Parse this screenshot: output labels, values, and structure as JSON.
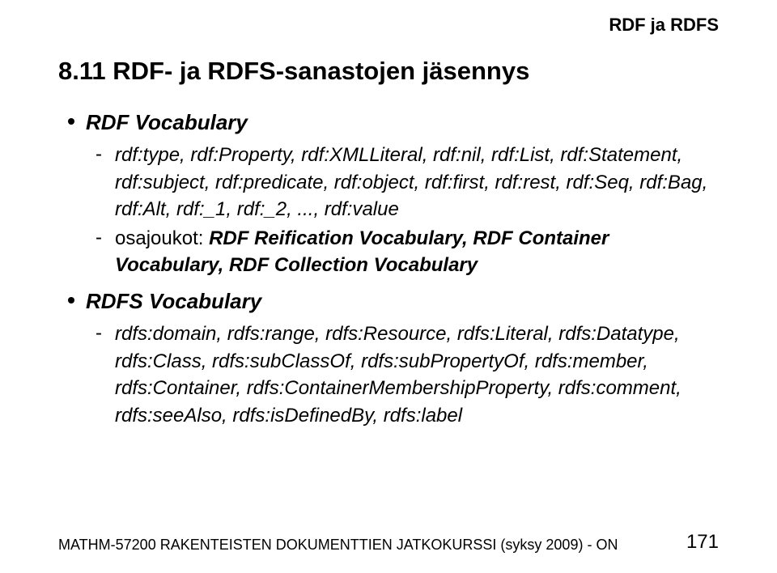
{
  "header": "RDF ja RDFS",
  "title": "8.11 RDF- ja RDFS-sanastojen jäsennys",
  "sections": [
    {
      "heading": "RDF Vocabulary",
      "items": [
        {
          "text": "rdf:type, rdf:Property, rdf:XMLLiteral, rdf:nil, rdf:List, rdf:Statement, rdf:subject, rdf:predicate, rdf:object, rdf:first, rdf:rest, rdf:Seq, rdf:Bag, rdf:Alt, rdf:_1, rdf:_2, ..., rdf:value"
        },
        {
          "prefix": "osajoukot:  ",
          "bold": "RDF Reification Vocabulary, RDF Container Vocabulary, RDF Collection Vocabulary"
        }
      ]
    },
    {
      "heading": "RDFS Vocabulary",
      "items": [
        {
          "text": "rdfs:domain, rdfs:range, rdfs:Resource, rdfs:Literal, rdfs:Datatype, rdfs:Class, rdfs:subClassOf, rdfs:subPropertyOf, rdfs:member, rdfs:Container, rdfs:ContainerMembershipProperty, rdfs:comment, rdfs:seeAlso, rdfs:isDefinedBy, rdfs:label"
        }
      ]
    }
  ],
  "footer": {
    "left": "MATHM-57200 RAKENTEISTEN DOKUMENTTIEN JATKOKURSSI (syksy 2009) - ON",
    "page": "171"
  }
}
